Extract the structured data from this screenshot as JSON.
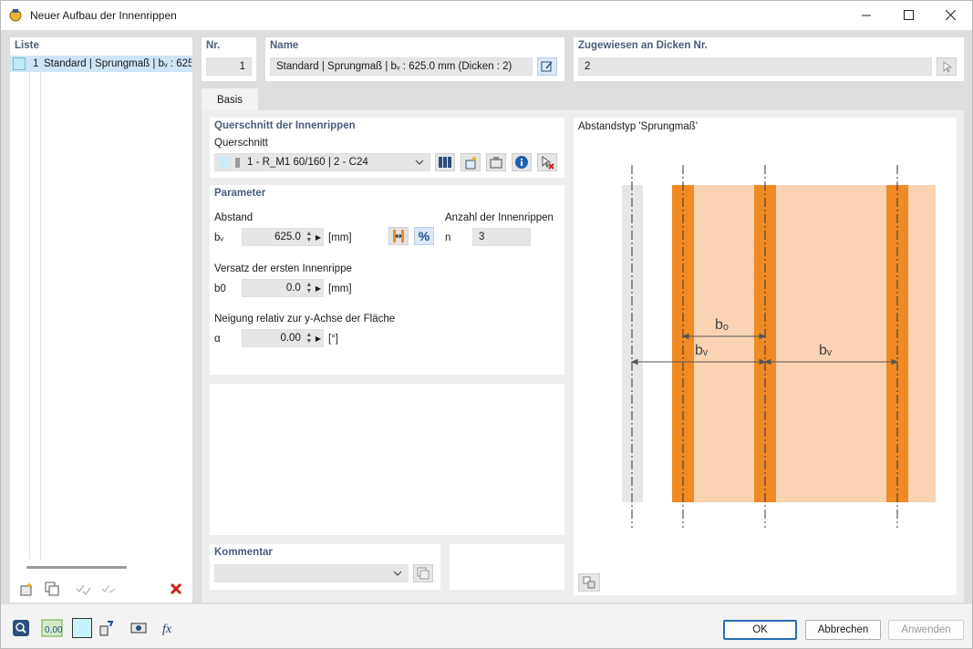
{
  "window": {
    "title": "Neuer Aufbau der Innenrippen",
    "minimize_icon": "minimize-icon",
    "maximize_icon": "maximize-icon",
    "close_icon": "close-icon"
  },
  "list": {
    "header": "Liste",
    "items": [
      {
        "nr": "1",
        "label": "Standard | Sprungmaß | bᵥ : 625"
      }
    ]
  },
  "nr": {
    "header": "Nr.",
    "value": "1"
  },
  "name": {
    "header": "Name",
    "value": "Standard | Sprungmaß | bᵥ : 625.0 mm (Dicken : 2)"
  },
  "assigned": {
    "header": "Zugewiesen an Dicken Nr.",
    "value": "2"
  },
  "tabs": [
    {
      "label": "Basis"
    }
  ],
  "cross_section": {
    "header": "Querschnitt der Innenrippen",
    "label": "Querschnitt",
    "value": "1 - R_M1 60/160 | 2 - C24"
  },
  "parameters": {
    "header": "Parameter",
    "spacing_label": "Abstand",
    "bv_symbol": "bᵥ",
    "bv_value": "625.0",
    "bv_unit": "[mm]",
    "count_label": "Anzahl der Innenrippen",
    "n_symbol": "n",
    "n_value": "3",
    "offset_label": "Versatz der ersten Innenrippe",
    "b0_symbol": "b0",
    "b0_value": "0.0",
    "b0_unit": "[mm]",
    "tilt_label": "Neigung relativ zur y-Achse der Fläche",
    "alpha_symbol": "α",
    "alpha_value": "0.00",
    "alpha_unit": "[°]"
  },
  "comment": {
    "header": "Kommentar",
    "value": ""
  },
  "diagram": {
    "title": "Abstandstyp 'Sprungmaß'",
    "label_bo": "bₒ",
    "label_bv1": "bᵥ",
    "label_bv2": "bᵥ",
    "colors": {
      "rib": "#f08a24",
      "fill": "#f9d3b2",
      "gray": "#e6e6e6"
    }
  },
  "buttons": {
    "ok": "OK",
    "cancel": "Abbrechen",
    "apply": "Anwenden"
  }
}
